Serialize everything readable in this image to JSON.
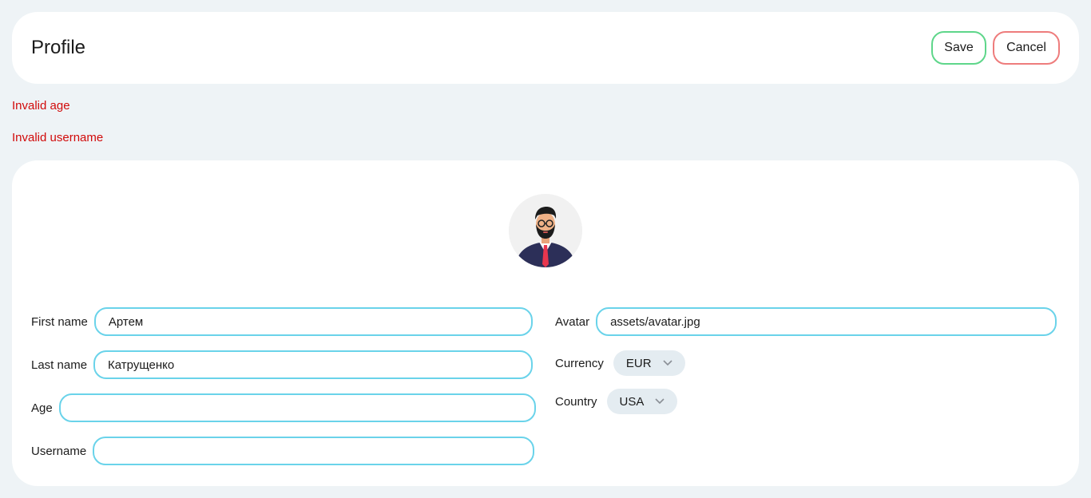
{
  "header": {
    "title": "Profile",
    "save_label": "Save",
    "cancel_label": "Cancel"
  },
  "errors": [
    "Invalid age",
    "Invalid username"
  ],
  "form": {
    "first_name": {
      "label": "First name",
      "value": "Артем"
    },
    "last_name": {
      "label": "Last name",
      "value": "Катрущенко"
    },
    "age": {
      "label": "Age",
      "value": ""
    },
    "username": {
      "label": "Username",
      "value": ""
    },
    "avatar": {
      "label": "Avatar",
      "value": "assets/avatar.jpg"
    },
    "currency": {
      "label": "Currency",
      "value": "EUR",
      "icon": "chevron-down-icon"
    },
    "country": {
      "label": "Country",
      "value": "USA",
      "icon": "chevron-down-icon"
    }
  },
  "colors": {
    "background": "#eef3f6",
    "save_border": "#5ed68a",
    "cancel_border": "#ee7c7c",
    "input_border": "#6ad3ea",
    "error_text": "#d10a0a",
    "select_bg": "#e4ecf1"
  }
}
